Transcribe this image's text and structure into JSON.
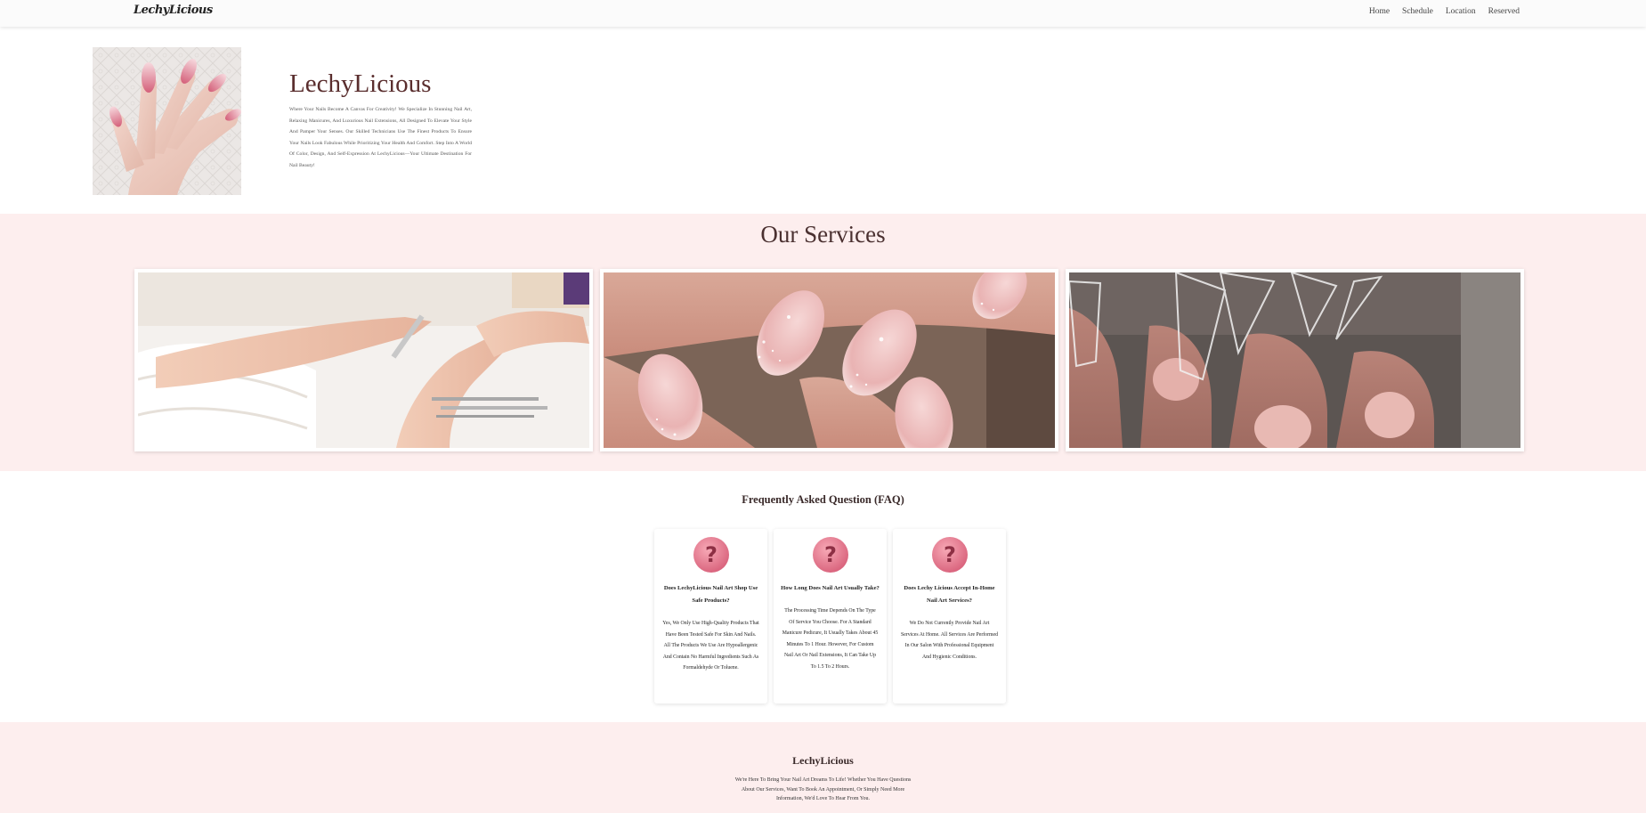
{
  "navbar": {
    "brand": "LechyLicious",
    "links": [
      "Home",
      "Schedule",
      "Location",
      "Reserved"
    ]
  },
  "hero": {
    "title": "LechyLicious",
    "description": "Where Your Nails Become A Canvas For Creativity! We Specialize In Stunning Nail Art, Relaxing Manicures, And Luxurious Nail Extensions, All Designed To Elevate Your Style And Pamper Your Senses. Our Skilled Technicians Use The Finest Products To Ensure Your Nails Look Fabulous While Prioritizing Your Health And Comfort. Step Into A World Of Color, Design, And Self-Expression At LechyLicious—Your Ultimate Destination For Nail Beauty!",
    "image_icon": "manicured-hand-photo"
  },
  "services": {
    "title": "Our Services",
    "images": [
      "manicure-filing-photo",
      "glitter-ombre-nails-photo",
      "nail-extension-tips-photo"
    ]
  },
  "faq": {
    "title": "Frequently Asked Question (FAQ)",
    "icon": "question-mark-icon",
    "items": [
      {
        "question": "Does LechyLicious Nail Art Shop Use Safe Products?",
        "answer": "Yes, We Only Use High-Quality Products That Have Been Tested Safe For Skin And Nails. All The Products We Use Are Hypoallergenic And Contain No Harmful Ingredients Such As Formaldehyde Or Toluene."
      },
      {
        "question": "How Long Does Nail Art Usually Take?",
        "answer": "The Processing Time Depends On The Type Of Service You Choose. For A Standard Manicure Pedicure, It Usually Takes About 45 Minutes To 1 Hour. However, For Custom Nail Art Or Nail Extensions, It Can Take Up To 1.5 To 2 Hours."
      },
      {
        "question": "Does Lechy Licious Accept In-Home Nail Art Services?",
        "answer": "We Do Not Currently Provide Nail Art Services At Home. All Services Are Performed In Our Salon With Professional Equipment And Hygienic Conditions."
      }
    ]
  },
  "footer": {
    "title": "LechyLicious",
    "description": "We're Here To Bring Your Nail Art Dreams To Life! Whether You Have Questions About Our Services, Want To Book An Appointment, Or Simply Need More Information, We'd Love To Hear From You."
  },
  "colors": {
    "accent_bg": "#fdeeee",
    "title_brown": "#5a2e2e",
    "faq_icon_pink": "#e87f92"
  }
}
